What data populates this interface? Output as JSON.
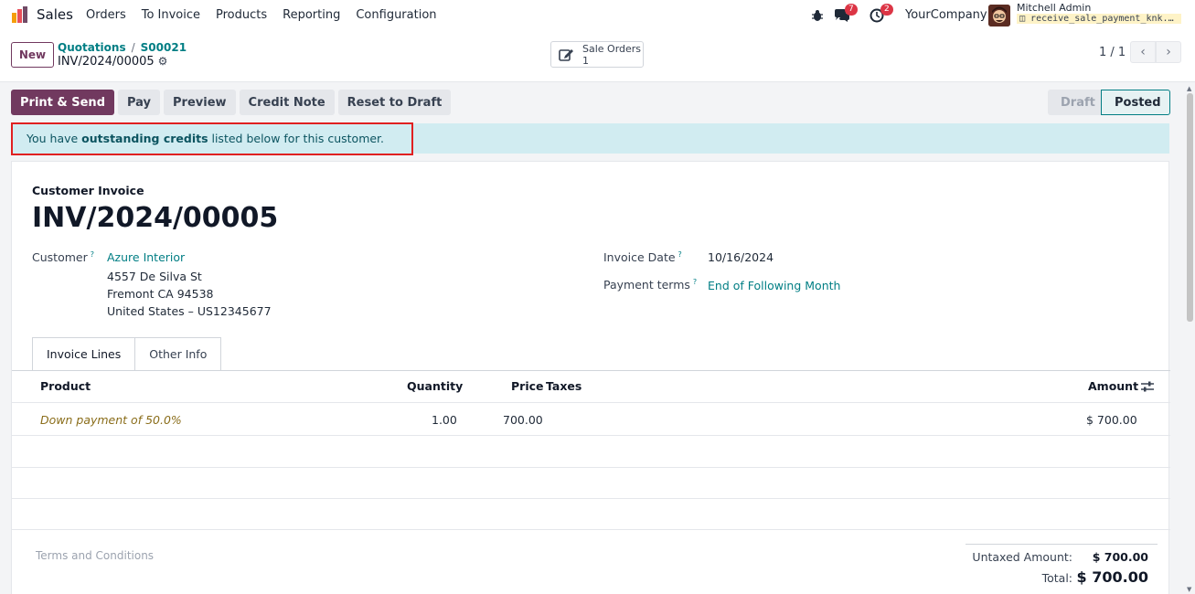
{
  "navbar": {
    "app_name": "Sales",
    "menu": [
      "Orders",
      "To Invoice",
      "Products",
      "Reporting",
      "Configuration"
    ],
    "chat_count": "7",
    "activity_count": "2",
    "company": "YourCompany",
    "user_name": "Mitchell Admin",
    "database": "receive_sale_payment_knk..."
  },
  "control": {
    "new_label": "New",
    "breadcrumb": [
      "Quotations",
      "S00021"
    ],
    "record_name": "INV/2024/00005",
    "smart_button": {
      "label": "Sale Orders",
      "count": "1"
    },
    "pager": "1 / 1"
  },
  "actions": [
    "Print & Send",
    "Pay",
    "Preview",
    "Credit Note",
    "Reset to Draft"
  ],
  "status": [
    "Draft",
    "Posted"
  ],
  "alert": {
    "prefix": "You have ",
    "bold": "outstanding credits",
    "suffix": " listed below for this customer."
  },
  "invoice": {
    "type": "Customer Invoice",
    "name": "INV/2024/00005",
    "customer_label": "Customer",
    "customer": "Azure Interior",
    "address": [
      "4557 De Silva St",
      "Fremont CA 94538",
      "United States – US12345677"
    ],
    "invoice_date_label": "Invoice Date",
    "invoice_date": "10/16/2024",
    "payment_terms_label": "Payment terms",
    "payment_terms": "End of Following Month"
  },
  "tabs": [
    "Invoice Lines",
    "Other Info"
  ],
  "table": {
    "headers": {
      "product": "Product",
      "quantity": "Quantity",
      "price": "Price",
      "taxes": "Taxes",
      "amount": "Amount"
    },
    "rows": [
      {
        "product": "Down payment of 50.0%",
        "quantity": "1.00",
        "price": "700.00",
        "taxes": "",
        "amount": "$ 700.00"
      }
    ]
  },
  "footer": {
    "terms_placeholder": "Terms and Conditions",
    "untaxed_label": "Untaxed Amount:",
    "untaxed_value": "$ 700.00",
    "total_label": "Total:",
    "total_value": "$ 700.00"
  },
  "colors": {
    "primary": "#71395f",
    "link": "#017e84",
    "alert_bg": "#d1ecf1",
    "highlight_border": "#e02020"
  }
}
